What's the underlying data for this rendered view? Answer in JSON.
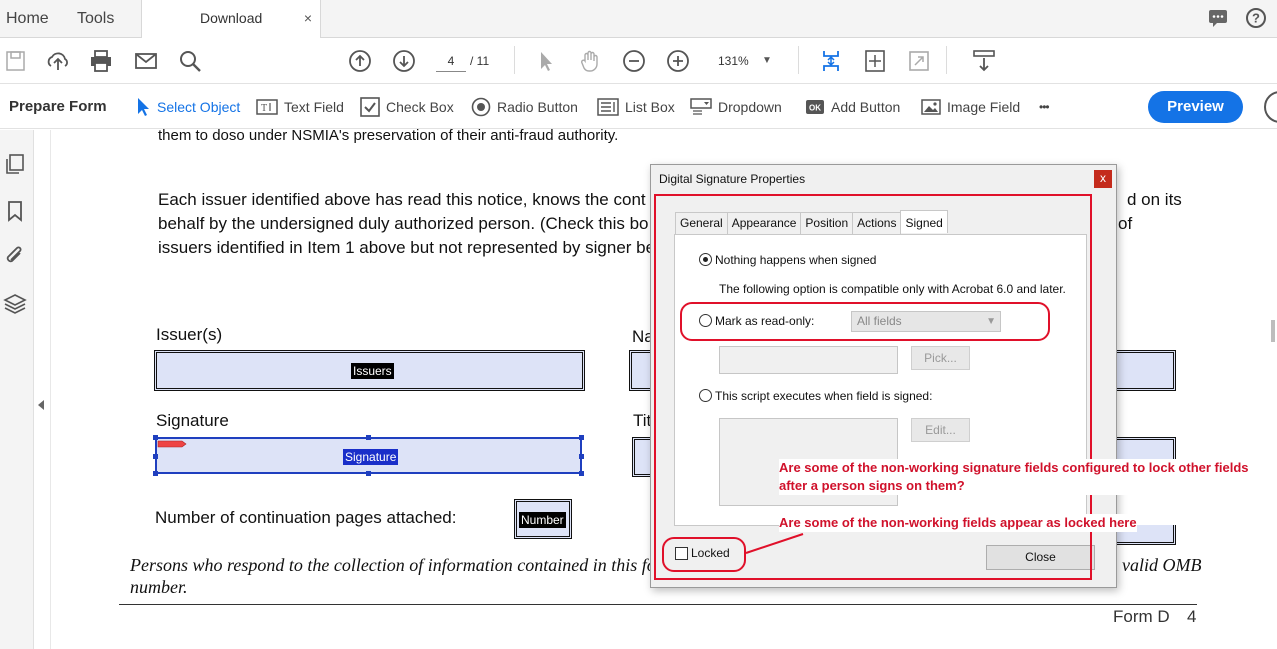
{
  "tabs": {
    "home": "Home",
    "tools": "Tools",
    "download": "Download",
    "close": "×"
  },
  "toolbar": {
    "page_current": "4",
    "page_total": "/ 11",
    "zoom": "131%"
  },
  "form_bar": {
    "title": "Prepare Form",
    "tools": [
      "Select Object",
      "Text Field",
      "Check Box",
      "Radio Button",
      "List Box",
      "Dropdown",
      "Add Button",
      "Image Field"
    ],
    "more": "•••",
    "preview": "Preview"
  },
  "document": {
    "line_top": "them to doso under NSMIA's preservation of their anti-fraud authority.",
    "para_1": "Each issuer identified above has read this notice, knows the cont",
    "para_2": "behalf by the undersigned duly authorized person.  (Check this bo",
    "para_3": "issuers identified in Item 1 above but not represented by signer be",
    "para_1_end": "d on its",
    "para_2_end": "of",
    "issuers_label": "Issuer(s)",
    "name_label": "Na",
    "signature_label": "Signature",
    "title_label": "Tit",
    "issuers_field": "Issuers",
    "signature_field": "Signature",
    "continuation_label": "Number of continuation pages attached:",
    "number_field": "Number",
    "footer_note": "Persons who respond to the collection of information contained in this for",
    "footer_note_end": "valid OMB",
    "footer_note_2": "number.",
    "form_label": "Form D",
    "page_number": "4"
  },
  "dialog": {
    "title": "Digital Signature Properties",
    "close_x": "x",
    "tabs": [
      "General",
      "Appearance",
      "Position",
      "Actions",
      "Signed"
    ],
    "active_tab": "Signed",
    "option_nothing": "Nothing happens when signed",
    "compat_note": "The following option is compatible only with Acrobat 6.0 and later.",
    "option_readonly": "Mark as read-only:",
    "fields_select": "All fields",
    "pick_button": "Pick...",
    "option_script": "This script executes when field is signed:",
    "edit_button": "Edit...",
    "locked_label": "Locked",
    "close_button": "Close"
  },
  "annotations": {
    "note_1": "Are some of the non-working signature fields configured to lock other fields after a person signs on them?",
    "note_2": "Are some of the non-working fields appear as locked here"
  },
  "colors": {
    "accent": "#1473e6",
    "annotation": "#e0102a",
    "field_fill": "#dde3f7"
  }
}
